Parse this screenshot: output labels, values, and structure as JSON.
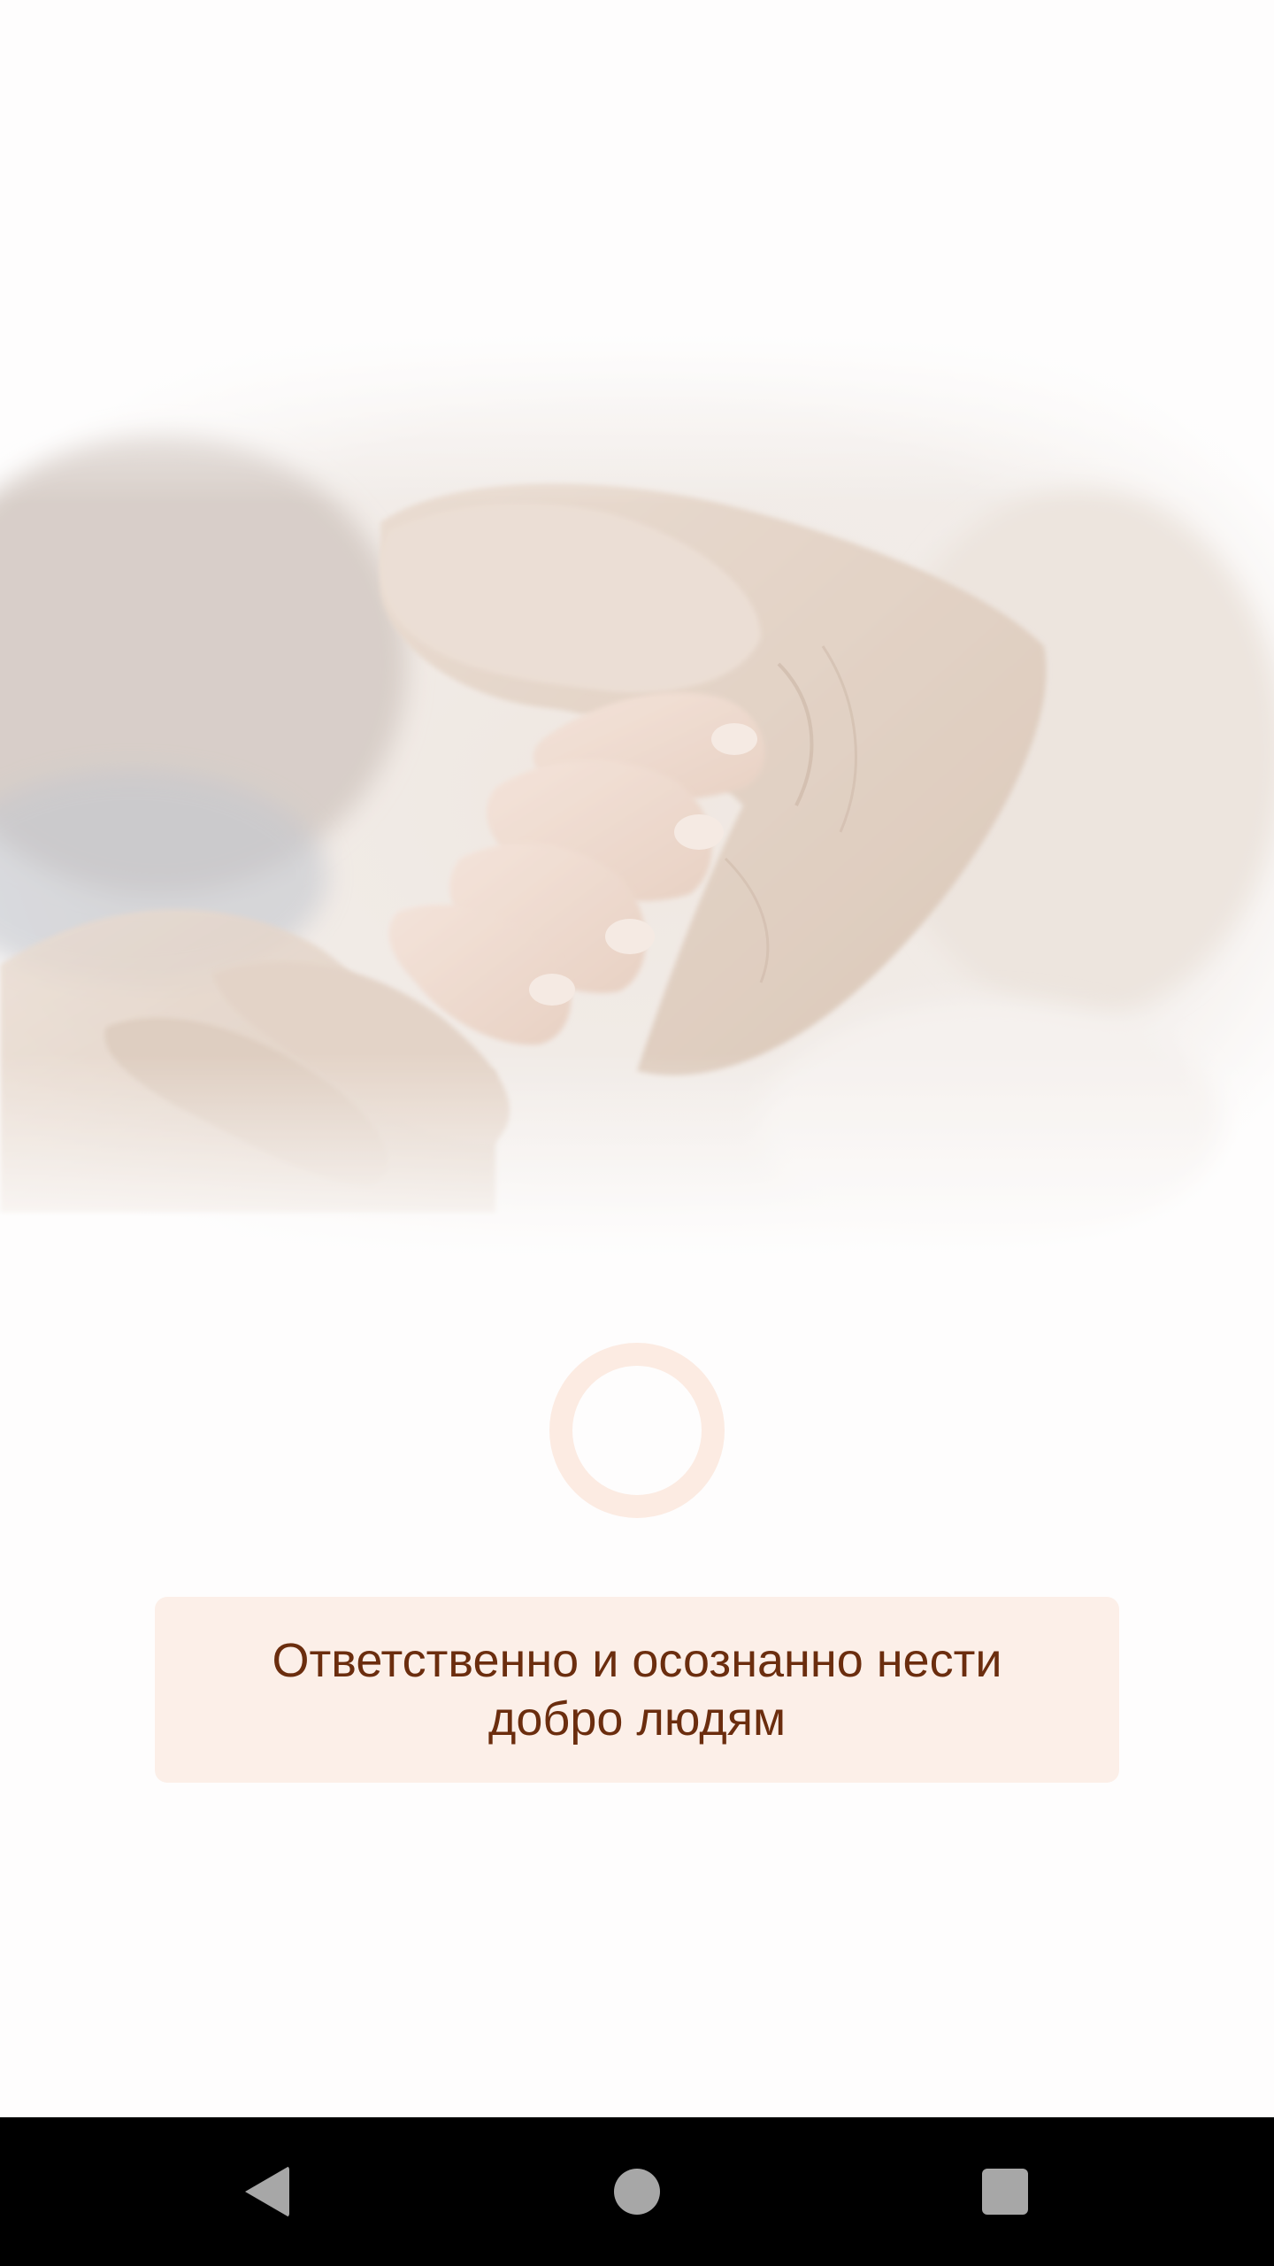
{
  "splash": {
    "hero_image": "hands-holding-photo",
    "loading_indicator": "progress-ring",
    "slogan": "Ответственно и осознанно нести добро людям"
  },
  "colors": {
    "background": "#fefdfd",
    "card_background": "#fcefe8",
    "slogan_text": "#6b2d0e",
    "spinner": "#fcebe2",
    "nav_bar": "#000000",
    "nav_icons": "#a7a7a7"
  },
  "navigation_bar": {
    "back_icon": "back-triangle-icon",
    "home_icon": "home-circle-icon",
    "recents_icon": "recents-square-icon"
  }
}
